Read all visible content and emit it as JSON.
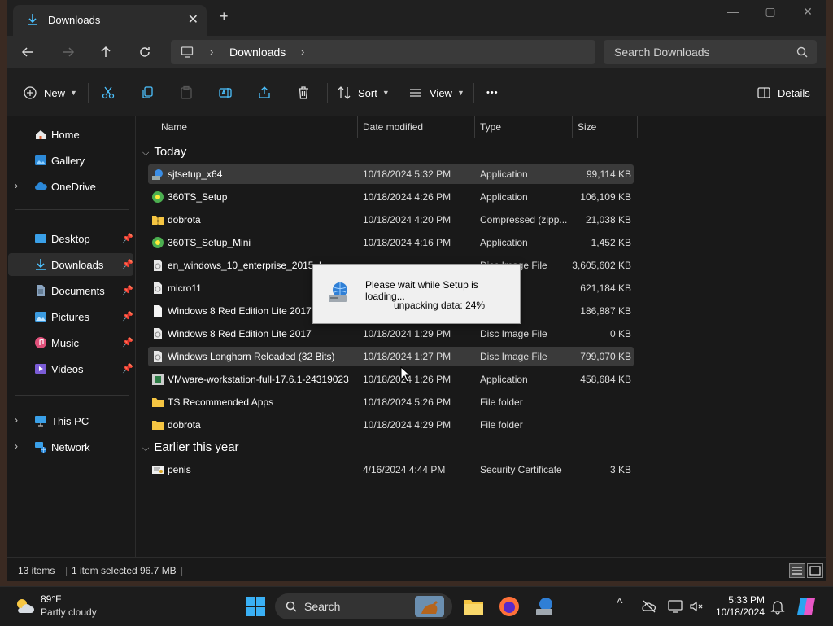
{
  "window": {
    "tab_title": "Downloads",
    "tab_close": "✕",
    "new_tab": "+",
    "minimize": "—",
    "maximize": "▢",
    "close": "✕"
  },
  "nav": {
    "breadcrumb": "Downloads",
    "search_placeholder": "Search Downloads"
  },
  "commands": {
    "new": "New",
    "sort": "Sort",
    "view": "View",
    "more": "•••",
    "details": "Details"
  },
  "sidebar": {
    "items": [
      {
        "label": "Home",
        "icon": "home-icon"
      },
      {
        "label": "Gallery",
        "icon": "gallery-icon"
      },
      {
        "label": "OneDrive",
        "icon": "onedrive-icon"
      },
      {
        "label": "Desktop",
        "icon": "desktop-icon"
      },
      {
        "label": "Downloads",
        "icon": "downloads-icon"
      },
      {
        "label": "Documents",
        "icon": "documents-icon"
      },
      {
        "label": "Pictures",
        "icon": "pictures-icon"
      },
      {
        "label": "Music",
        "icon": "music-icon"
      },
      {
        "label": "Videos",
        "icon": "videos-icon"
      },
      {
        "label": "This PC",
        "icon": "this-pc-icon"
      },
      {
        "label": "Network",
        "icon": "network-icon"
      }
    ]
  },
  "columns": {
    "name": "Name",
    "date": "Date modified",
    "type": "Type",
    "size": "Size"
  },
  "groups": {
    "today": "Today",
    "earlier": "Earlier this year"
  },
  "files": [
    {
      "name": "sjtsetup_x64",
      "date": "10/18/2024 5:32 PM",
      "type": "Application",
      "size": "99,114 KB"
    },
    {
      "name": "360TS_Setup",
      "date": "10/18/2024 4:26 PM",
      "type": "Application",
      "size": "106,109 KB"
    },
    {
      "name": "dobrota",
      "date": "10/18/2024 4:20 PM",
      "type": "Compressed (zipp...",
      "size": "21,038 KB"
    },
    {
      "name": "360TS_Setup_Mini",
      "date": "10/18/2024 4:16 PM",
      "type": "Application",
      "size": "1,452 KB"
    },
    {
      "name": "en_windows_10_enterprise_2015_l",
      "date": "",
      "type": "Disc Image File",
      "size": "3,605,602 KB"
    },
    {
      "name": "micro11",
      "date": "",
      "type": "ge File",
      "size": "621,184 KB"
    },
    {
      "name": "Windows 8 Red Edition Lite 2017.k",
      "date": "",
      "type": "",
      "size": "186,887 KB"
    },
    {
      "name": "Windows 8 Red Edition Lite 2017",
      "date": "10/18/2024 1:29 PM",
      "type": "Disc Image File",
      "size": "0 KB"
    },
    {
      "name": "Windows Longhorn Reloaded (32 Bits)",
      "date": "10/18/2024 1:27 PM",
      "type": "Disc Image File",
      "size": "799,070 KB"
    },
    {
      "name": "VMware-workstation-full-17.6.1-24319023",
      "date": "10/18/2024 1:26 PM",
      "type": "Application",
      "size": "458,684 KB"
    },
    {
      "name": "TS Recommended Apps",
      "date": "10/18/2024 5:26 PM",
      "type": "File folder",
      "size": ""
    },
    {
      "name": "dobrota",
      "date": "10/18/2024 4:29 PM",
      "type": "File folder",
      "size": ""
    },
    {
      "name": "penis",
      "date": "4/16/2024 4:44 PM",
      "type": "Security Certificate",
      "size": "3 KB"
    }
  ],
  "status": {
    "count": "13 items",
    "selected": "1 item selected",
    "size": "96.7 MB"
  },
  "dialog": {
    "line1": "Please wait while Setup is loading...",
    "line2": "unpacking data: 24%"
  },
  "taskbar": {
    "temp": "89°F",
    "condition": "Partly cloudy",
    "search": "Search",
    "time": "5:33 PM",
    "date": "10/18/2024"
  },
  "colors": {
    "accent": "#4cc2ff",
    "folder": "#f5c542",
    "background": "#191919"
  }
}
